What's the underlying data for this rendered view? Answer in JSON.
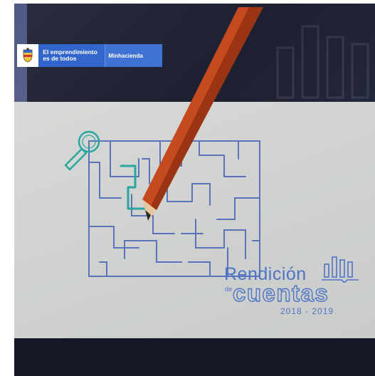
{
  "brand": {
    "slogan_line1": "El emprendimiento",
    "slogan_line2": "es de todos",
    "ministry": "Minhacienda",
    "crest_icon": "colombia-coat-of-arms-icon"
  },
  "graphic": {
    "title": "Rendición",
    "de": "de",
    "cuentas": "cuentas",
    "years": "2018 - 2019"
  },
  "colors": {
    "background_dark": "#1f2230",
    "paper": "#d1d4d1",
    "maze_line": "#5b73b8",
    "maze_path": "#28a6a0",
    "brand_blue": "#3366cc",
    "title_blue": "#4f73c8"
  },
  "icons": [
    "pencil-icon",
    "magnifier-icon",
    "maze-illustration",
    "bar-chart-icon"
  ]
}
